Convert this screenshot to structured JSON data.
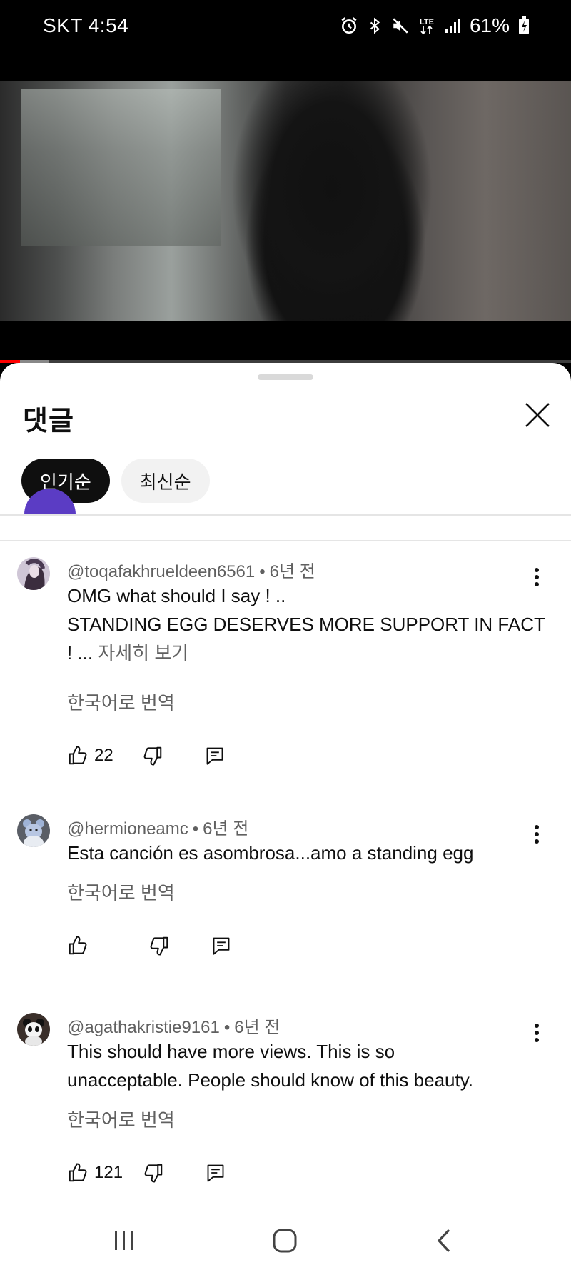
{
  "status_bar": {
    "carrier_time": "SKT 4:54",
    "battery": "61%",
    "network": "LTE"
  },
  "video": {
    "progress_fraction": 0.035,
    "buffer_fraction": 0.085,
    "progress_color": "#ff0000"
  },
  "comments_panel": {
    "title": "댓글",
    "sort_chips": [
      {
        "label": "인기순",
        "active": true
      },
      {
        "label": "최신순",
        "active": false
      }
    ],
    "comments": [
      {
        "author": "@toqafakhrueldeen6561",
        "time": "6년 전",
        "lines": [
          "OMG what should I say ! ..",
          "STANDING EGG DESERVES MORE SUPPORT IN FACT"
        ],
        "last_line": "! ...",
        "see_more": "자세히 보기",
        "translate": "한국어로 번역",
        "likes": "22",
        "avatar_icon": "anime-girl-avatar"
      },
      {
        "author": "@hermioneamc",
        "time": "6년 전",
        "lines": [
          "Esta canción es asombrosa...amo a standing egg"
        ],
        "translate": "한국어로 번역",
        "likes": "",
        "avatar_icon": "teddy-bear-avatar"
      },
      {
        "author": "@agathakristie9161",
        "time": "6년 전",
        "lines": [
          "This should have more views. This is so",
          "unacceptable. People should know of this beauty."
        ],
        "translate": "한국어로 번역",
        "likes": "121",
        "avatar_icon": "panda-avatar"
      }
    ]
  }
}
